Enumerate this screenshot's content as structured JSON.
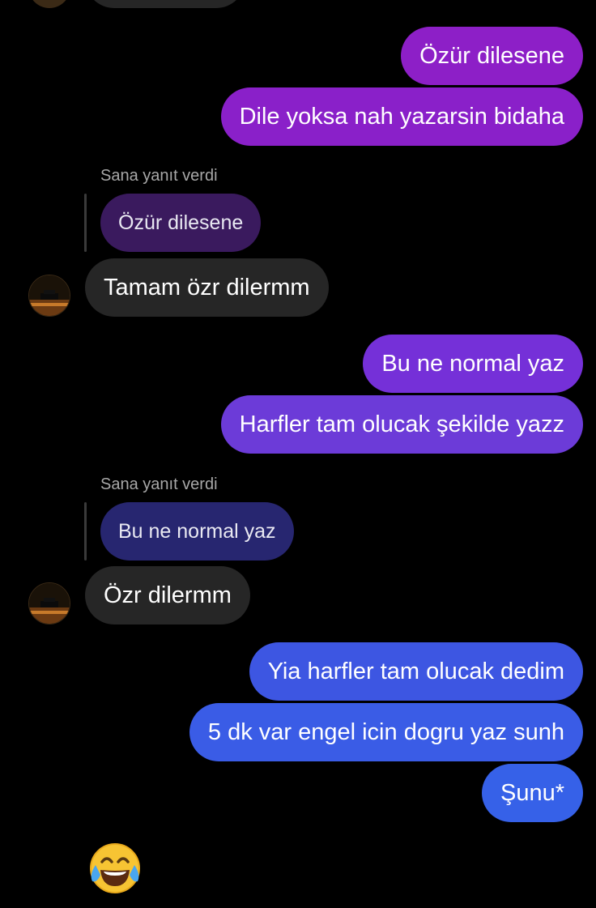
{
  "conversation": {
    "reply_label": "Sana yanıt verdi",
    "messages": [
      {
        "text": "Özür dilesene",
        "color": "#8d1fc7"
      },
      {
        "text": "Dile yoksa nah yazarsin bidaha",
        "color": "#8d1fc7"
      },
      {
        "quoted": "Özür dilesene",
        "quoted_color": "#3a1a5e"
      },
      {
        "text": "Tamam özr dilermm"
      },
      {
        "text": "Bu ne normal yaz",
        "color": "#6e36d6"
      },
      {
        "text": "Harfler tam olucak şekilde yazz",
        "color": "#6e36d6"
      },
      {
        "quoted": "Bu ne normal yaz",
        "quoted_color": "#272670"
      },
      {
        "text": "Özr dilermm"
      },
      {
        "text": "Yia harfler tam olucak dedim",
        "color": "#3a5ee6"
      },
      {
        "text": "5 dk var engel icin dogru yaz sunh",
        "color": "#3a5ee6"
      },
      {
        "text": "Şunu*",
        "color": "#3a5ee6"
      }
    ],
    "reaction_icon": "face-with-tears-of-joy-icon"
  }
}
